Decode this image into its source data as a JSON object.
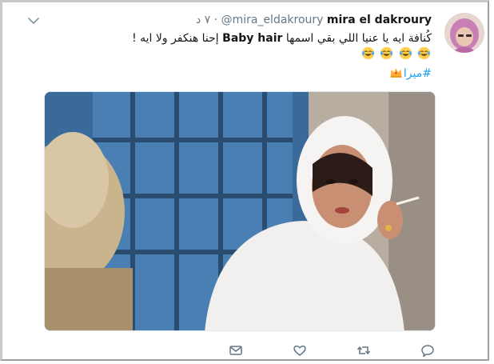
{
  "tweet": {
    "author": {
      "name": "mira el dakroury",
      "handle": "@mira_eldakroury",
      "time": "٧ د"
    },
    "body": {
      "line1": "كُنافة ايه يا عنيا اللي بقي اسمها",
      "bold_phrase": "Baby hair",
      "line2": "إحنا هنكفر ولا ايه !",
      "emojis": [
        "face-with-tears-of-joy",
        "face-with-tears-of-joy",
        "face-with-tears-of-joy",
        "face-with-tears-of-joy"
      ]
    },
    "hashtag": "#ميرا",
    "hashtag_emoji": "crown",
    "media": {
      "description": "photo"
    },
    "actions": [
      "reply-icon",
      "retweet-icon",
      "like-icon",
      "message-icon"
    ]
  }
}
